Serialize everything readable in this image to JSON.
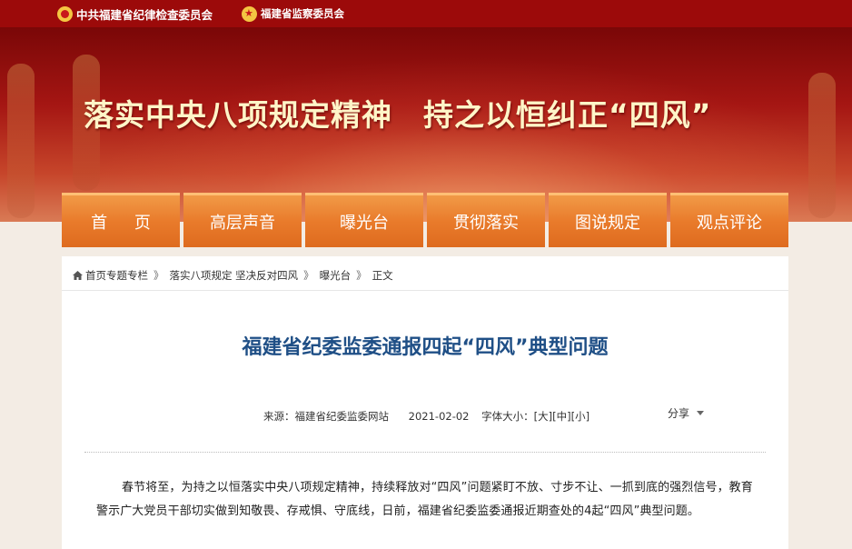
{
  "header": {
    "org_primary": "中共福建省纪律检查委员会",
    "org_secondary": "福建省监察委员会",
    "emblem_primary_icon": "party-emblem-icon",
    "emblem_secondary_icon": "national-emblem-icon"
  },
  "banner": {
    "slogan1": "落实中央八项规定精神",
    "slogan2": "持之以恒纠正“四风”"
  },
  "nav": {
    "items": [
      {
        "label": "首 页"
      },
      {
        "label": "高层声音"
      },
      {
        "label": "曝光台"
      },
      {
        "label": "贯彻落实"
      },
      {
        "label": "图说规定"
      },
      {
        "label": "观点评论"
      }
    ]
  },
  "breadcrumb": {
    "items": [
      "首页专题专栏",
      "落实八项规定 坚决反对四风",
      "曝光台",
      "正文"
    ],
    "separator": "》"
  },
  "article": {
    "title": "福建省纪委监委通报四起“四风”典型问题",
    "source_label": "来源：福建省纪委监委网站",
    "date": "2021-02-02",
    "font_size_label": "字体大小：",
    "font_large": "[大]",
    "font_medium": "[中]",
    "font_small": "[小]",
    "share_label": "分享",
    "body": "春节将至，为持之以恒落实中央八项规定精神，持续释放对“四风”问题紧盯不放、寸步不让、一抓到底的强烈信号，教育警示广大党员干部切实做到知敬畏、存戒惧、守底线，日前，福建省纪委监委通报近期查处的4起“四风”典型问题。"
  },
  "colors": {
    "topbar": "#9c0a0a",
    "nav_orange": "#e97b2b",
    "title_blue": "#1f4f86",
    "banner_text": "#fff5c8"
  }
}
